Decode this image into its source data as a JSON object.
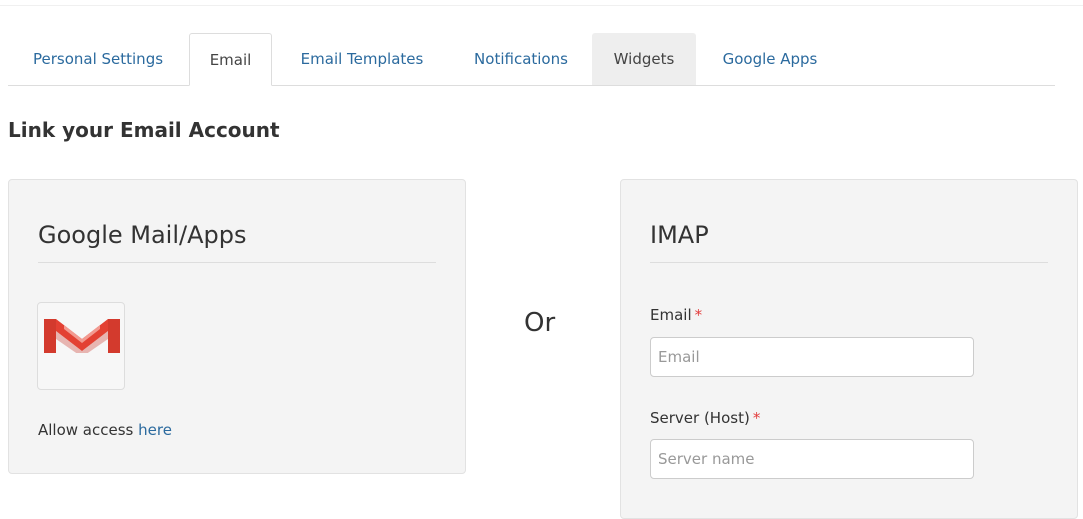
{
  "tabs": [
    {
      "label": "Personal Settings",
      "state": "normal"
    },
    {
      "label": "Email",
      "state": "active"
    },
    {
      "label": "Email Templates",
      "state": "normal"
    },
    {
      "label": "Notifications",
      "state": "normal"
    },
    {
      "label": "Widgets",
      "state": "hover"
    },
    {
      "label": "Google Apps",
      "state": "normal"
    }
  ],
  "section_title": "Link your Email Account",
  "google_panel": {
    "heading": "Google Mail/Apps",
    "icon": "gmail-icon",
    "allow_prefix": "Allow access",
    "allow_link": "here"
  },
  "separator_text": "Or",
  "imap_panel": {
    "heading": "IMAP",
    "email_label": "Email",
    "email_required_mark": "*",
    "email_placeholder": "Email",
    "email_value": "",
    "server_label": "Server (Host)",
    "server_required_mark": "*",
    "server_placeholder": "Server name",
    "server_value": ""
  },
  "colors": {
    "link": "#2b6a9e",
    "required": "#e23b3b",
    "panel_bg": "#f4f4f4",
    "gmail_red": "#e34133"
  }
}
